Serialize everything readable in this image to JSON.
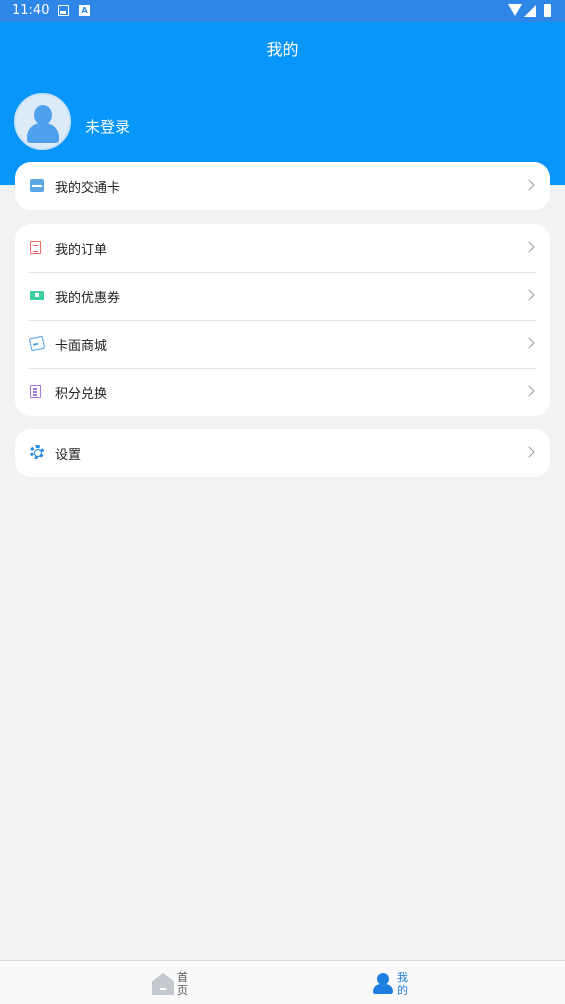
{
  "status_bar": {
    "time": "11:40",
    "notification_icons": [
      "image-icon",
      "a-icon"
    ],
    "system_icons": [
      "wifi-icon",
      "signal-icon",
      "battery-icon"
    ]
  },
  "header": {
    "title": "我的",
    "background": "#0896fa"
  },
  "user": {
    "name": "未登录",
    "avatar_icon": "user-avatar-icon"
  },
  "sections": {
    "card": {
      "label": "我的交通卡",
      "icon": "transit-card-icon"
    },
    "menu": [
      {
        "label": "我的订单",
        "icon": "order-icon",
        "color": "#ef6a63"
      },
      {
        "label": "我的优惠券",
        "icon": "coupon-icon",
        "color": "#3ccf9c"
      },
      {
        "label": "卡面商城",
        "icon": "card-shop-icon",
        "color": "#4ea1ec"
      },
      {
        "label": "积分兑换",
        "icon": "points-exchange-icon",
        "color": "#a07ae0"
      }
    ],
    "settings": {
      "label": "设置",
      "icon": "gear-icon",
      "color": "#1e88e5"
    }
  },
  "tabbar": {
    "items": [
      {
        "label": "首页",
        "icon": "home-icon",
        "active": false
      },
      {
        "label": "我的",
        "icon": "profile-icon",
        "active": true
      }
    ],
    "active_color": "#1f7fe0"
  }
}
